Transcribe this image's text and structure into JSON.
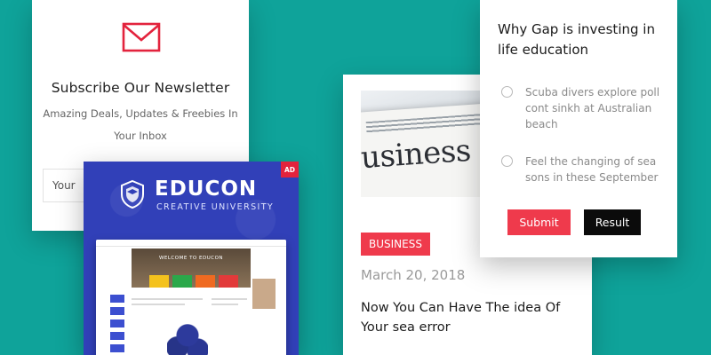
{
  "newsletter": {
    "title": "Subscribe Our Newsletter",
    "subtitle": "Amazing Deals, Updates & Freebies In Your Inbox",
    "input_value": "Your",
    "icon": "mail-icon",
    "accent_color": "#e3233d"
  },
  "ad": {
    "badge": "AD",
    "brand": "EDUCON",
    "brand_sub": "CREATIVE UNIVERSITY",
    "mockup_title": "WELCOME TO EDUCON",
    "background_color": "#3140b8"
  },
  "post": {
    "image_word": "usiness",
    "category": "BUSINESS",
    "date": "March 20, 2018",
    "headline": "Now You Can Have The idea Of Your sea error",
    "category_color": "#ef3a4c"
  },
  "poll": {
    "question": "Why Gap is investing in life education",
    "options": [
      {
        "label": "Scuba divers explore poll cont sinkh at Australian beach"
      },
      {
        "label": "Feel the changing of sea sons in these September"
      }
    ],
    "submit_label": "Submit",
    "result_label": "Result",
    "submit_color": "#ef3a4c",
    "result_color": "#0b0b0b"
  },
  "page": {
    "background_color": "#0fa39a"
  }
}
